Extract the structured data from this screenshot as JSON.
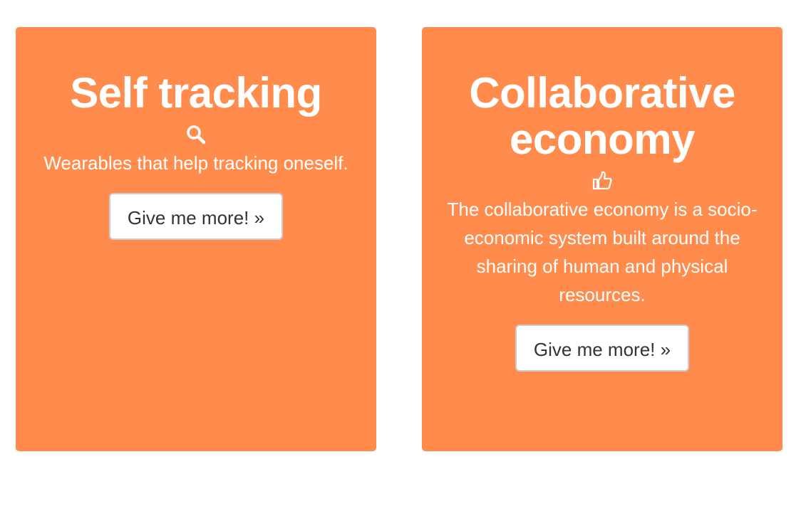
{
  "cards": [
    {
      "title": "Self tracking",
      "icon": "search-icon",
      "description": "Wearables that help tracking oneself.",
      "button_label": "Give me more! »"
    },
    {
      "title": "Collaborative economy",
      "icon": "thumbs-up-icon",
      "description": "The collaborative economy is a socio-economic system built around the sharing of human and physical resources.",
      "button_label": "Give me more! »"
    }
  ],
  "colors": {
    "card_background": "#ff8c4c",
    "card_text": "#ffffff",
    "button_background": "#ffffff",
    "button_text": "#333333"
  }
}
